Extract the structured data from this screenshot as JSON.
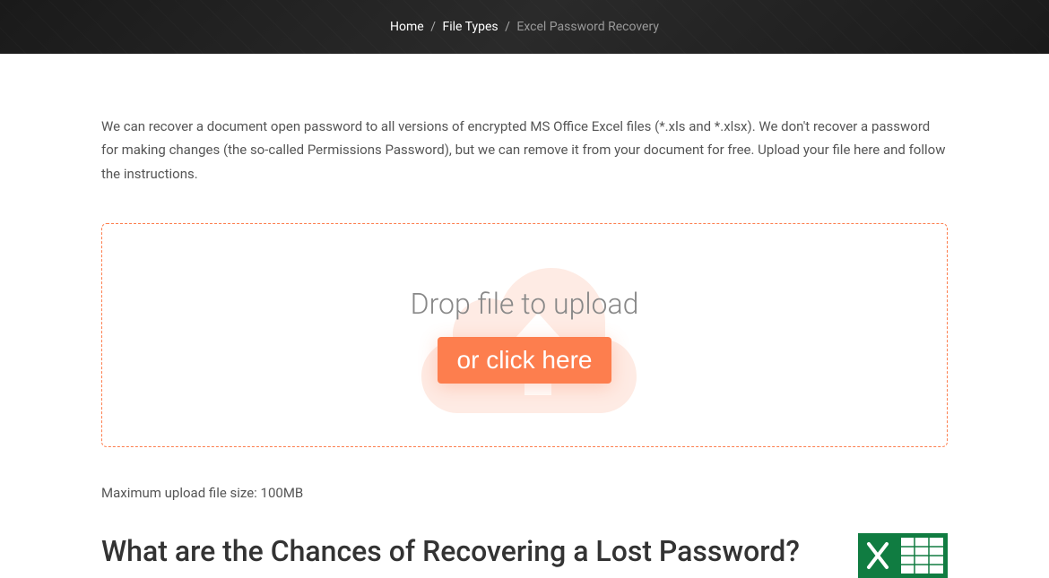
{
  "breadcrumb": {
    "home": "Home",
    "file_types": "File Types",
    "current": "Excel Password Recovery"
  },
  "intro": "We can recover a document open password to all versions of encrypted MS Office Excel files (*.xls and *.xlsx). We don't recover a password for making changes (the so-called Permissions Password), but we can remove it from your document for free. Upload your file here and follow the instructions.",
  "upload": {
    "drop_text": "Drop file to upload",
    "button_label": "or click here"
  },
  "max_size": "Maximum upload file size: 100MB",
  "section": {
    "heading": "What are the Chances of Recovering a Lost Password?"
  },
  "colors": {
    "accent": "#fd7e4e",
    "excel_green": "#107C41"
  }
}
